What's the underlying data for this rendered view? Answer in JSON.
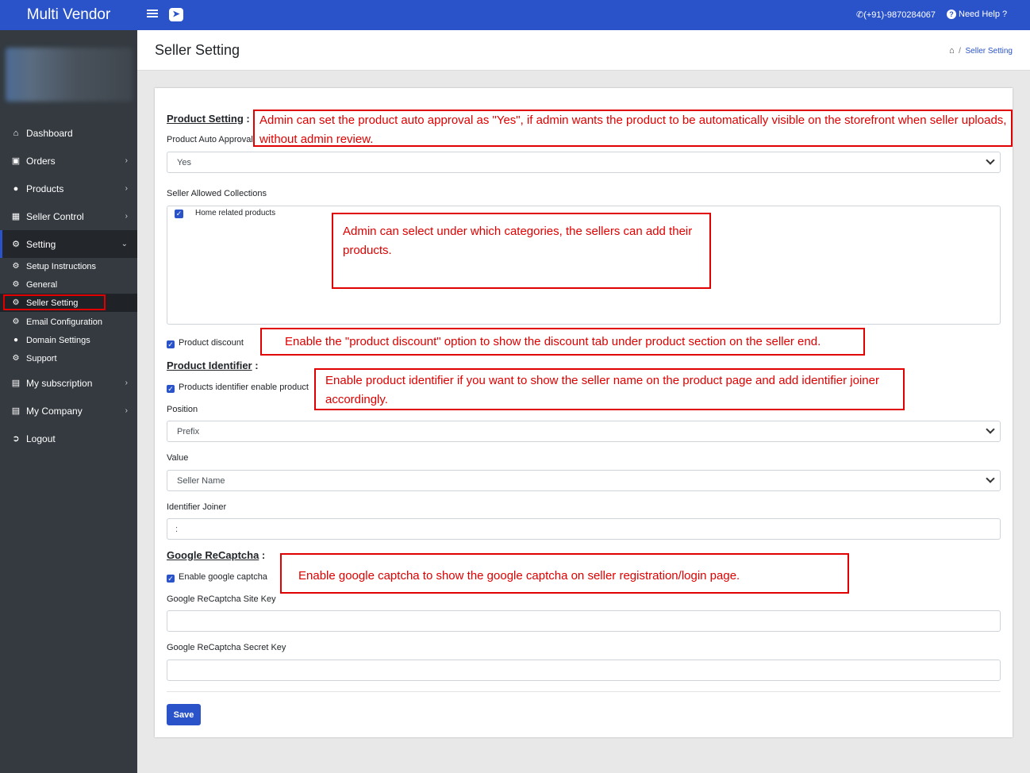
{
  "brand": "Multi Vendor",
  "topbar": {
    "phone": "(+91)-9870284067",
    "help": "Need Help ?"
  },
  "header": {
    "title": "Seller Setting",
    "breadcrumb_current": "Seller Setting"
  },
  "sidebar": {
    "items": [
      {
        "label": "Dashboard",
        "icon": "home-icon"
      },
      {
        "label": "Orders",
        "icon": "cart-icon"
      },
      {
        "label": "Products",
        "icon": "product-icon"
      },
      {
        "label": "Seller Control",
        "icon": "building-icon"
      },
      {
        "label": "Setting",
        "icon": "cogs-icon"
      },
      {
        "label": "My subscription",
        "icon": "card-icon"
      },
      {
        "label": "My Company",
        "icon": "id-card-icon"
      },
      {
        "label": "Logout",
        "icon": "logout-icon"
      }
    ],
    "sub_items": [
      {
        "label": "Setup Instructions"
      },
      {
        "label": "General"
      },
      {
        "label": "Seller Setting"
      },
      {
        "label": "Email Configuration"
      },
      {
        "label": "Domain Settings"
      },
      {
        "label": "Support"
      }
    ]
  },
  "form": {
    "product_setting_title": "Product Setting",
    "auto_approval_label": "Product Auto Approval",
    "auto_approval_value": "Yes",
    "collections_label": "Seller Allowed Collections",
    "collection_item": "Home related products",
    "product_discount_label": "Product discount",
    "product_identifier_title": "Product Identifier",
    "identifier_enable_label": "Products identifier enable product",
    "position_label": "Position",
    "position_value": "Prefix",
    "value_label": "Value",
    "value_value": "Seller Name",
    "joiner_label": "Identifier Joiner",
    "joiner_value": ":",
    "recaptcha_title": "Google ReCaptcha",
    "enable_captcha_label": "Enable google captcha",
    "site_key_label": "Google ReCaptcha Site Key",
    "site_key_value": "",
    "secret_key_label": "Google ReCaptcha Secret Key",
    "secret_key_value": "",
    "save_label": "Save"
  },
  "annotations": {
    "auto_approval": "Admin can set the product auto approval as \"Yes\", if admin wants the product to be automatically visible on the storefront when seller uploads, without admin review.",
    "collections": "Admin can select under which categories, the sellers can add their products.",
    "discount": "Enable the \"product discount\" option to show the discount tab under product section on the seller end.",
    "identifier": "Enable product identifier if you want to show the seller name on the product page and add identifier joiner accordingly.",
    "captcha": "Enable google captcha to show the google captcha on seller registration/login page."
  }
}
